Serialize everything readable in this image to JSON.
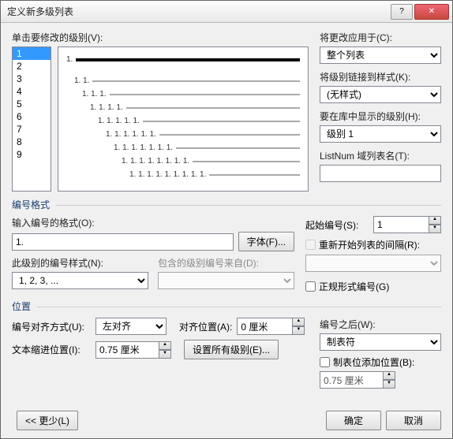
{
  "title": "定义新多级列表",
  "levels_label": "单击要修改的级别(V):",
  "levels": [
    "1",
    "2",
    "3",
    "4",
    "5",
    "6",
    "7",
    "8",
    "9"
  ],
  "selected_level": 0,
  "preview_lines": [
    {
      "num": "1.",
      "thick": true
    },
    {
      "num": "",
      "gray": false,
      "blank": true,
      "thick": true
    },
    {
      "num": "1. 1.",
      "gray": true
    },
    {
      "num": "1. 1. 1.",
      "gray": true
    },
    {
      "num": "1. 1. 1. 1.",
      "gray": true
    },
    {
      "num": "1. 1. 1. 1. 1.",
      "gray": true
    },
    {
      "num": "1. 1. 1. 1. 1. 1.",
      "gray": true
    },
    {
      "num": "1. 1. 1. 1. 1. 1. 1.",
      "gray": true
    },
    {
      "num": "1. 1. 1. 1. 1. 1. 1. 1.",
      "gray": true
    },
    {
      "num": "1. 1. 1. 1. 1. 1. 1. 1. 1.",
      "gray": true
    }
  ],
  "apply_to_label": "将更改应用于(C):",
  "apply_to_value": "整个列表",
  "link_style_label": "将级别链接到样式(K):",
  "link_style_value": "(无样式)",
  "gallery_label": "要在库中显示的级别(H):",
  "gallery_value": "级别 1",
  "listnum_label": "ListNum 域列表名(T):",
  "listnum_value": "",
  "format_group": "编号格式",
  "format_input_label": "输入编号的格式(O):",
  "format_input_value": "1.",
  "font_btn": "字体(F)...",
  "style_label": "此级别的编号样式(N):",
  "style_value": "1, 2, 3, ...",
  "include_label": "包含的级别编号来自(D):",
  "include_value": "",
  "start_label": "起始编号(S):",
  "start_value": "1",
  "restart_label": "重新开始列表的间隔(R):",
  "restart_value": "",
  "legal_label": "正规形式编号(G)",
  "position_group": "位置",
  "align_label": "编号对齐方式(U):",
  "align_value": "左对齐",
  "align_at_label": "对齐位置(A):",
  "align_at_value": "0 厘米",
  "indent_label": "文本缩进位置(I):",
  "indent_value": "0.75 厘米",
  "set_all_btn": "设置所有级别(E)...",
  "follow_label": "编号之后(W):",
  "follow_value": "制表符",
  "tab_add_label": "制表位添加位置(B):",
  "tab_add_value": "0.75 厘米",
  "less_btn": "<< 更少(L)",
  "ok_btn": "确定",
  "cancel_btn": "取消"
}
